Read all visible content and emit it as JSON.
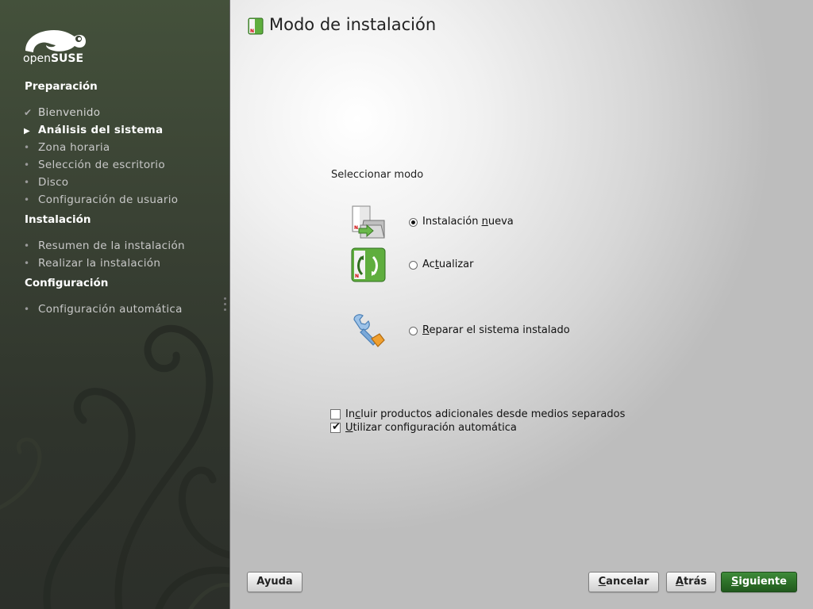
{
  "colors": {
    "sidebar_bg": "#3a4234",
    "accent_green": "#2c6e27",
    "main_bg": "#e6e6e6"
  },
  "sidebar": {
    "logo_text_light": "open",
    "logo_text_bold": "SUSE",
    "sections": [
      {
        "title": "Preparación",
        "steps": [
          {
            "label": "Bienvenido",
            "state": "done",
            "marker_icon": "check-icon"
          },
          {
            "label": "Análisis del sistema",
            "state": "current",
            "marker_icon": "arrow-right-icon"
          },
          {
            "label": "Zona horaria",
            "state": "pending",
            "marker_icon": "bullet-icon"
          },
          {
            "label": "Selección de escritorio",
            "state": "pending",
            "marker_icon": "bullet-icon"
          },
          {
            "label": "Disco",
            "state": "pending",
            "marker_icon": "bullet-icon"
          },
          {
            "label": "Configuración de usuario",
            "state": "pending",
            "marker_icon": "bullet-icon"
          }
        ]
      },
      {
        "title": "Instalación",
        "steps": [
          {
            "label": "Resumen de la instalación",
            "state": "pending",
            "marker_icon": "bullet-icon"
          },
          {
            "label": "Realizar la instalación",
            "state": "pending",
            "marker_icon": "bullet-icon"
          }
        ]
      },
      {
        "title": "Configuración",
        "steps": [
          {
            "label": "Configuración automática",
            "state": "pending",
            "marker_icon": "bullet-icon"
          }
        ]
      }
    ]
  },
  "main": {
    "title": "Modo de instalación",
    "mode_label": "Seleccionar modo",
    "options": [
      {
        "pre": "Instalación ",
        "mnemonic": "n",
        "post": "ueva",
        "selected": true,
        "icon": "new-install-icon"
      },
      {
        "pre": "Ac",
        "mnemonic": "t",
        "post": "ualizar",
        "selected": false,
        "icon": "update-icon"
      },
      {
        "pre": "",
        "mnemonic": "R",
        "post": "eparar el sistema instalado",
        "selected": false,
        "icon": "repair-wrench-icon"
      }
    ],
    "checkboxes": [
      {
        "pre": "In",
        "mnemonic": "c",
        "post": "luir productos adicionales desde medios separados",
        "checked": false
      },
      {
        "pre": "",
        "mnemonic": "U",
        "post": "tilizar configuración automática",
        "checked": true
      }
    ]
  },
  "buttons": {
    "help": "Ayuda",
    "cancel": {
      "mnemonic": "C",
      "rest": "ancelar"
    },
    "back": {
      "mnemonic": "A",
      "rest": "trás"
    },
    "next": {
      "mnemonic": "S",
      "rest": "iguiente"
    }
  }
}
